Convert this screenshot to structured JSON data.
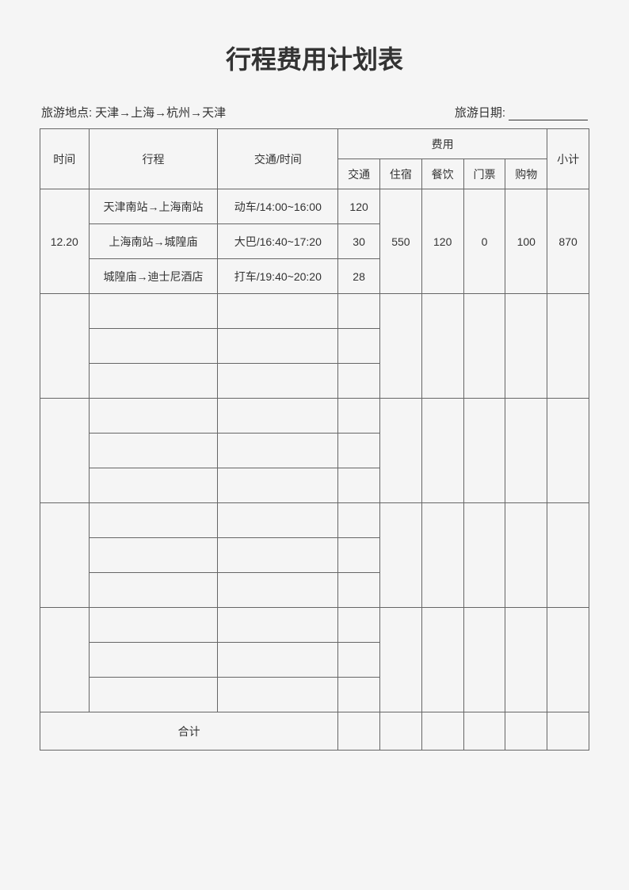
{
  "title": "行程费用计划表",
  "info": {
    "location_label": "旅游地点:",
    "location_value": "天津→上海→杭州→天津",
    "date_label": "旅游日期:"
  },
  "headers": {
    "time": "时间",
    "route": "行程",
    "transport": "交通/时间",
    "cost": "费用",
    "cost_transport": "交通",
    "cost_lodging": "住宿",
    "cost_food": "餐饮",
    "cost_ticket": "门票",
    "cost_shopping": "购物",
    "subtotal": "小计"
  },
  "blocks": [
    {
      "date": "12.20",
      "routes": [
        {
          "route": "天津南站→上海南站",
          "transport": "动车/14:00~16:00",
          "cost": "120"
        },
        {
          "route": "上海南站→城隍庙",
          "transport": "大巴/16:40~17:20",
          "cost": "30"
        },
        {
          "route": "城隍庙→迪士尼酒店",
          "transport": "打车/19:40~20:20",
          "cost": "28"
        }
      ],
      "lodging": "550",
      "food": "120",
      "ticket": "0",
      "shopping": "100",
      "subtotal": "870"
    },
    {
      "date": "",
      "routes": [
        {
          "route": "",
          "transport": "",
          "cost": ""
        },
        {
          "route": "",
          "transport": "",
          "cost": ""
        },
        {
          "route": "",
          "transport": "",
          "cost": ""
        }
      ],
      "lodging": "",
      "food": "",
      "ticket": "",
      "shopping": "",
      "subtotal": ""
    },
    {
      "date": "",
      "routes": [
        {
          "route": "",
          "transport": "",
          "cost": ""
        },
        {
          "route": "",
          "transport": "",
          "cost": ""
        },
        {
          "route": "",
          "transport": "",
          "cost": ""
        }
      ],
      "lodging": "",
      "food": "",
      "ticket": "",
      "shopping": "",
      "subtotal": ""
    },
    {
      "date": "",
      "routes": [
        {
          "route": "",
          "transport": "",
          "cost": ""
        },
        {
          "route": "",
          "transport": "",
          "cost": ""
        },
        {
          "route": "",
          "transport": "",
          "cost": ""
        }
      ],
      "lodging": "",
      "food": "",
      "ticket": "",
      "shopping": "",
      "subtotal": ""
    },
    {
      "date": "",
      "routes": [
        {
          "route": "",
          "transport": "",
          "cost": ""
        },
        {
          "route": "",
          "transport": "",
          "cost": ""
        },
        {
          "route": "",
          "transport": "",
          "cost": ""
        }
      ],
      "lodging": "",
      "food": "",
      "ticket": "",
      "shopping": "",
      "subtotal": ""
    }
  ],
  "total_label": "合计",
  "totals": {
    "transport": "",
    "lodging": "",
    "food": "",
    "ticket": "",
    "shopping": "",
    "subtotal": ""
  }
}
